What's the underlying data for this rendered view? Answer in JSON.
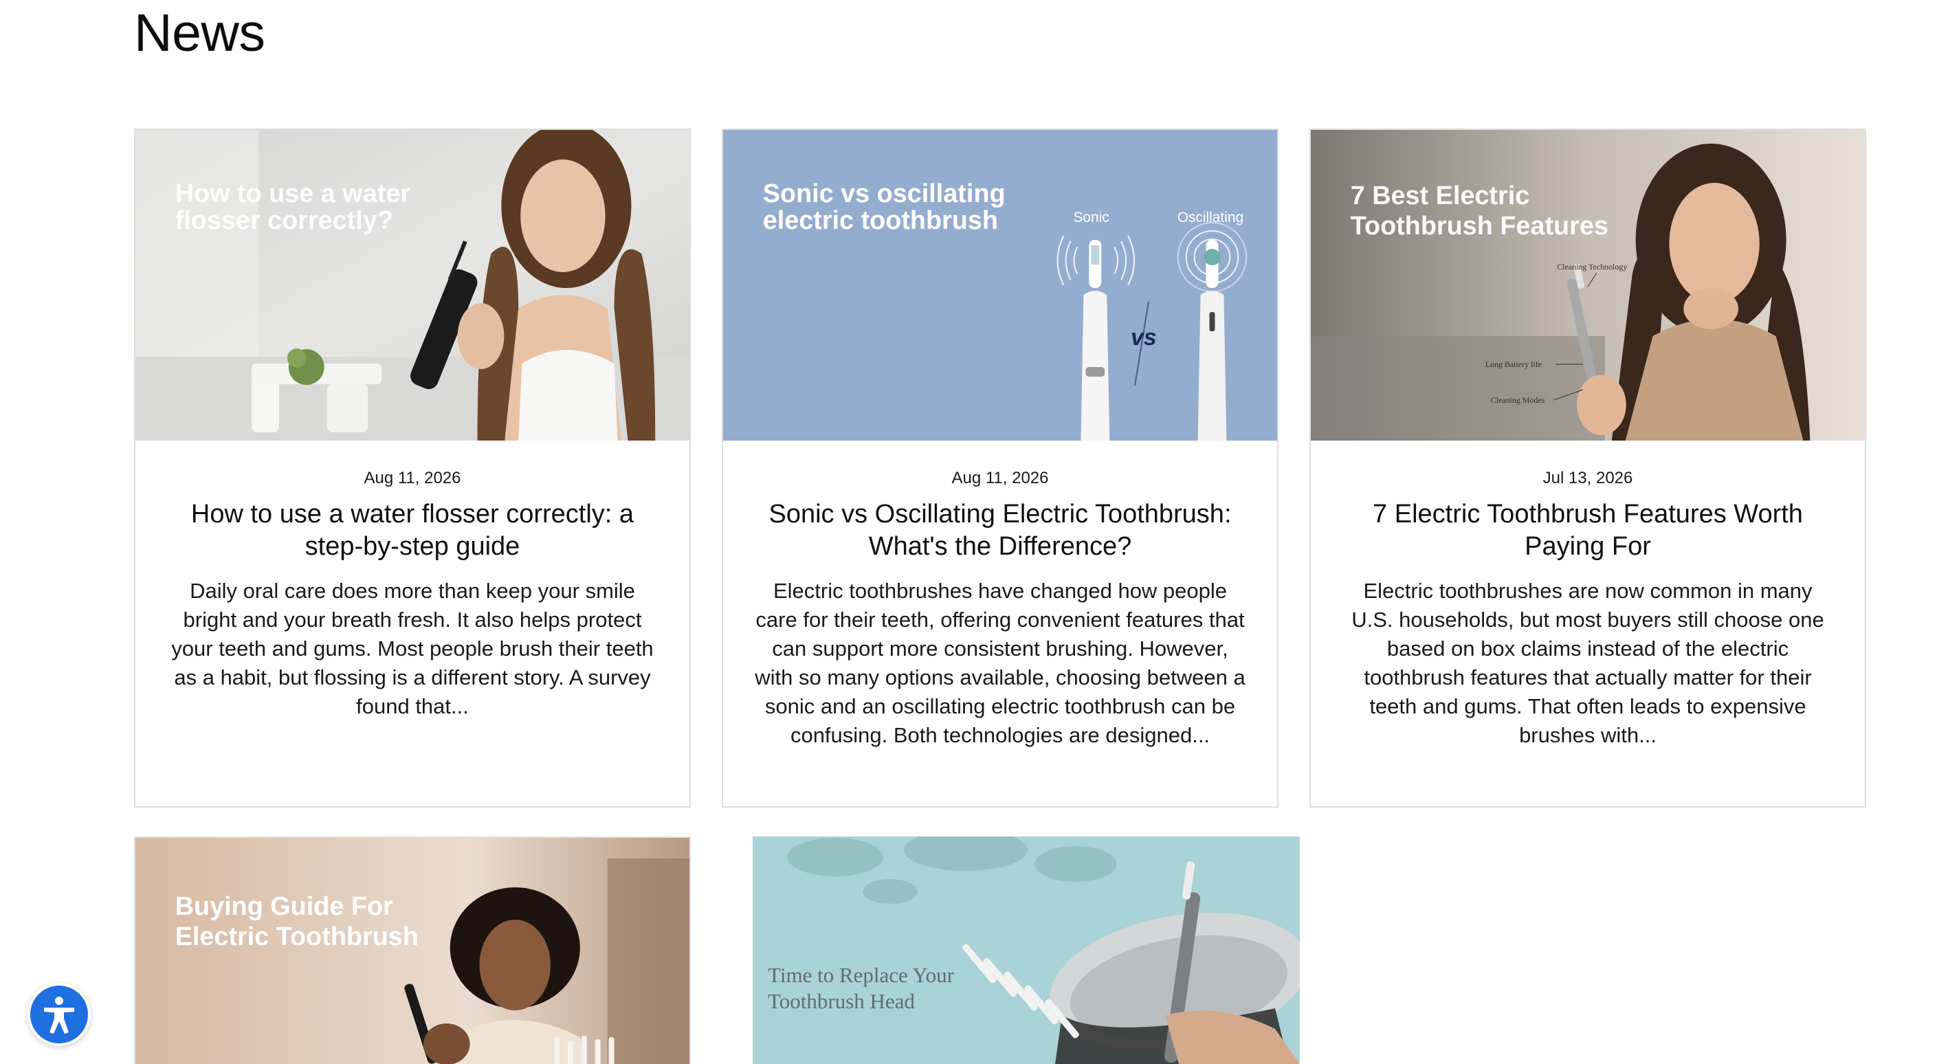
{
  "page": {
    "title": "News"
  },
  "colors": {
    "accent_blue": "#1f6fe0",
    "card_border": "#dedede",
    "card2_bg": "#94acce",
    "card5_bg": "#a9d3d6"
  },
  "posts": [
    {
      "image_text": [
        "How to use a water",
        "flosser correctly?"
      ],
      "date": "Aug 11, 2026",
      "title": "How to use a water flosser correctly: a step-by-step guide",
      "excerpt": "Daily oral care does more than keep your smile bright and your breath fresh. It also helps protect your teeth and gums. Most people brush their teeth as a habit, but flossing is a different story. A survey found that..."
    },
    {
      "image_text": [
        "Sonic vs oscillating",
        "electric toothbrush"
      ],
      "image_labels": {
        "left": "Sonic",
        "right": "Oscillating",
        "vs": "vs"
      },
      "date": "Aug 11, 2026",
      "title": "Sonic vs Oscillating Electric Toothbrush: What's the Difference?",
      "excerpt": "Electric toothbrushes have changed how people care for their teeth, offering convenient features that can support more consistent brushing. However, with so many options available, choosing between a sonic and an oscillating electric toothbrush can be confusing. Both technologies are designed..."
    },
    {
      "image_text": [
        "7 Best Electric",
        "Toothbrush Features"
      ],
      "image_labels": {
        "one": "Cleaning Technology",
        "two": "Long Battery life",
        "three": "Cleaning Modes"
      },
      "date": "Jul 13, 2026",
      "title": "7 Electric Toothbrush Features Worth Paying For",
      "excerpt": "Electric toothbrushes are now common in many U.S. households, but most buyers still choose one based on box claims instead of the electric toothbrush features that actually matter for their teeth and gums. That often leads to expensive brushes with..."
    },
    {
      "image_text": [
        "Buying Guide For",
        "Electric Toothbrush"
      ]
    },
    {
      "image_text": [
        "Time to Replace Your",
        "Toothbrush Head"
      ]
    }
  ],
  "icons": {
    "accessibility": "accessibility-icon"
  }
}
